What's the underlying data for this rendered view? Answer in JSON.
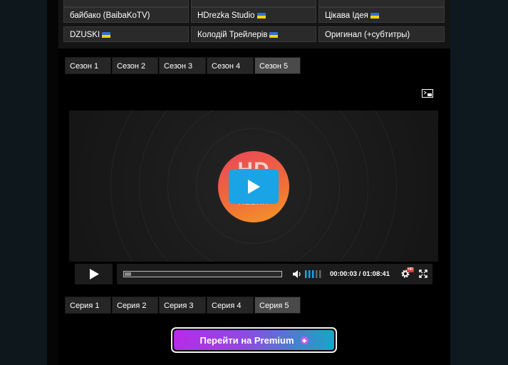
{
  "translations": {
    "rows": [
      [
        "",
        "",
        ""
      ],
      [
        "байбако (BaibaKoTV)",
        "HDrezka Studio",
        "Цікава Ідея"
      ],
      [
        "DZUSKI",
        "Колодій Трейлерів",
        "Оригинал (+субтитры)"
      ]
    ]
  },
  "seasons": [
    "Сезон 1",
    "Сезон 2",
    "Сезон 3",
    "Сезон 4",
    "Сезон 5"
  ],
  "active_season": "Сезон 5",
  "player": {
    "time_current": "00:00:03",
    "time_total": "01:08:41",
    "time_display": "00:00:03 / 01:08:41",
    "progress": 0.04,
    "volume_level": 0.6,
    "quality_badge": "HD"
  },
  "episodes": [
    "Серия 1",
    "Серия 2",
    "Серия 3",
    "Серия 4",
    "Серия 5"
  ],
  "active_episode": "Серия 5",
  "premium": {
    "label": "Перейти на Premium"
  },
  "colors": {
    "accent_play": "#1aa4e6",
    "premium_start": "#b82ae8",
    "premium_end": "#16a7c4"
  }
}
